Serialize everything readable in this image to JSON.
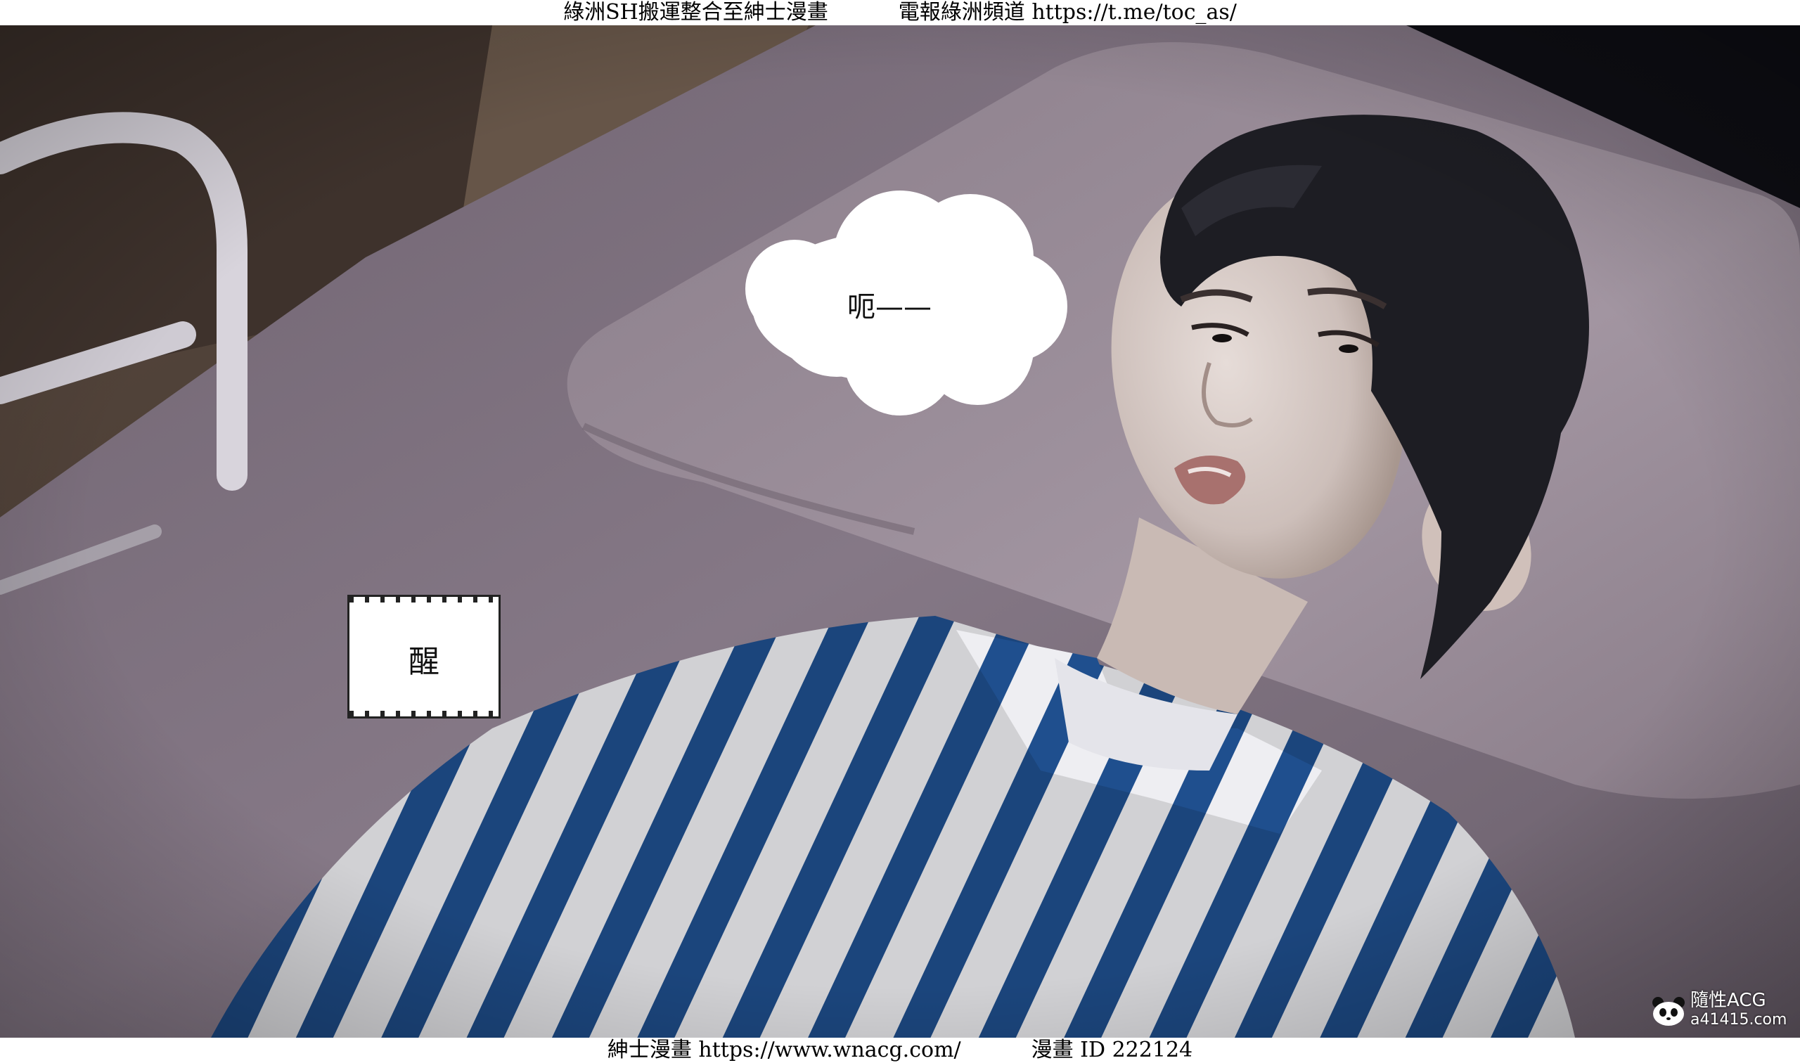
{
  "banner_top": {
    "left_text": "綠洲SH搬運整合至紳士漫畫",
    "right_text": "電報綠洲頻道 https://t.me/toc_as/"
  },
  "banner_bottom": {
    "left_text": "紳士漫畫 https://www.wnacg.com/",
    "right_text": "漫畫 ID 222124"
  },
  "scene": {
    "thought_bubble_text": "呃——",
    "caption_text": "醒",
    "watermark": {
      "brand": "隨性ACG",
      "site": "a41415.com",
      "icon": "panda-icon"
    }
  },
  "colors": {
    "bed_fabric": "#847783",
    "pillow": "#9b8e9a",
    "stripe_blue": "#1e4f8f",
    "stripe_white": "#f1f1f4",
    "hair": "#1d1d22",
    "skin": "#d9cdc8"
  }
}
